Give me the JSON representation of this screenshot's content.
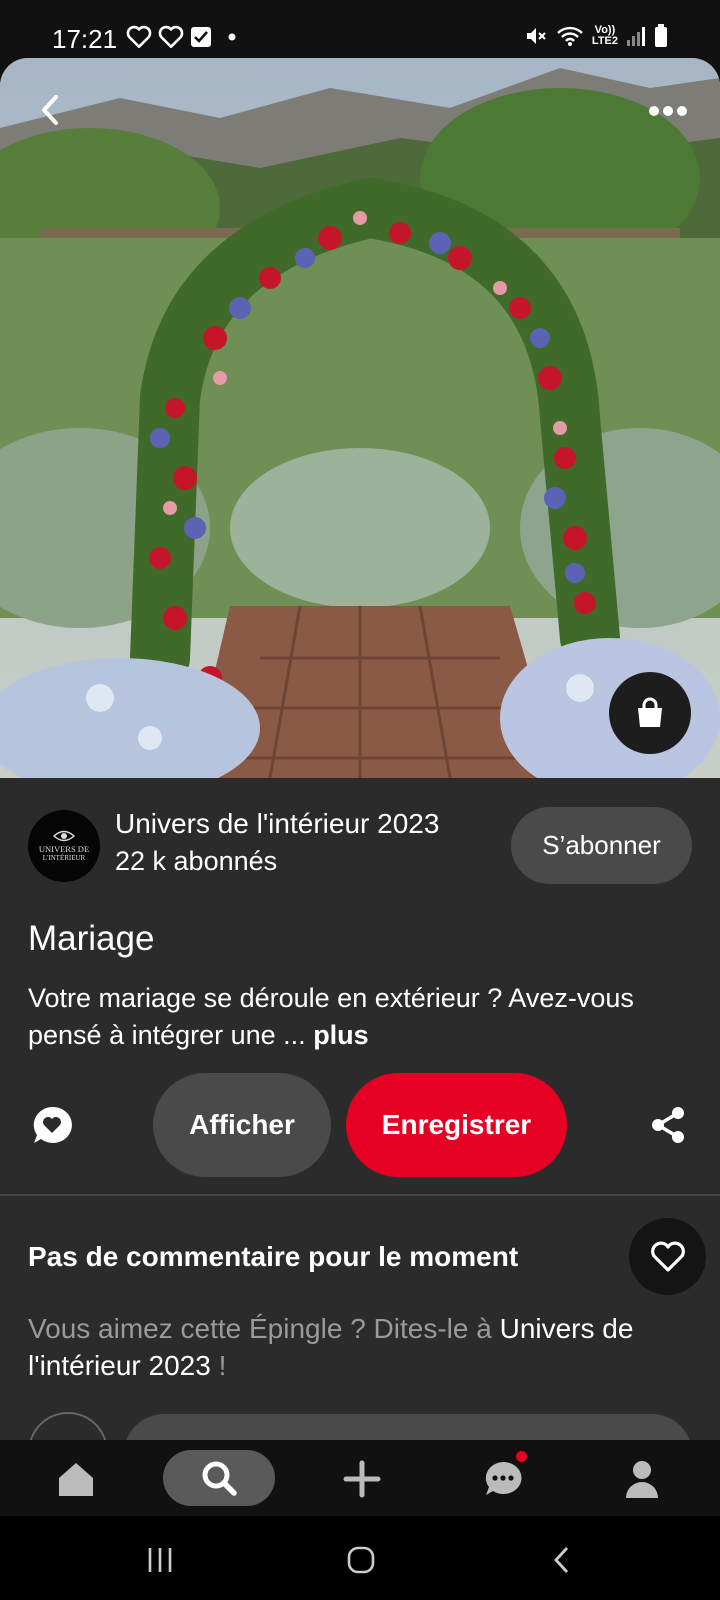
{
  "status_bar": {
    "time": "17:21",
    "left_icons": [
      "heart-outline-icon",
      "heart-outline-icon",
      "checkbox-icon",
      "dot-icon"
    ],
    "lte_label_line1": "Vo))",
    "lte_label_line2": "LTE2",
    "right_icons": [
      "mute-icon",
      "wifi-icon",
      "signal-icon",
      "battery-icon"
    ]
  },
  "hero": {
    "image_icons": [
      "back-arrow-icon",
      "more-options-icon",
      "shopping-bag-icon"
    ]
  },
  "creator": {
    "avatar_line1": "UNIVERS DE",
    "avatar_line2": "L'INTÉRIEUR",
    "name": "Univers de l'intérieur 2023",
    "followers": "22 k abonnés",
    "subscribe_label": "S’abonner"
  },
  "pin": {
    "title": "Mariage",
    "description": "Votre mariage se déroule en extérieur ? Avez-vous pensé à intégrer une ... ",
    "more_label": "plus"
  },
  "actions": {
    "view_label": "Afficher",
    "save_label": "Enregistrer",
    "save_color": "#e60023"
  },
  "comments": {
    "heading": "Pas de commentaire pour le moment",
    "prompt_prefix": "Vous aimez cette Épingle ? Dites-le à ",
    "prompt_creator": "Univers de l'intérieur 2023",
    "prompt_suffix": " !"
  },
  "bottom_nav": {
    "items": [
      "home-icon",
      "search-icon",
      "create-icon",
      "messages-icon",
      "profile-icon"
    ],
    "active": "search-icon",
    "messages_has_notification": true
  },
  "system_nav": {
    "items": [
      "recent-apps-icon",
      "home-button-icon",
      "back-icon"
    ]
  }
}
